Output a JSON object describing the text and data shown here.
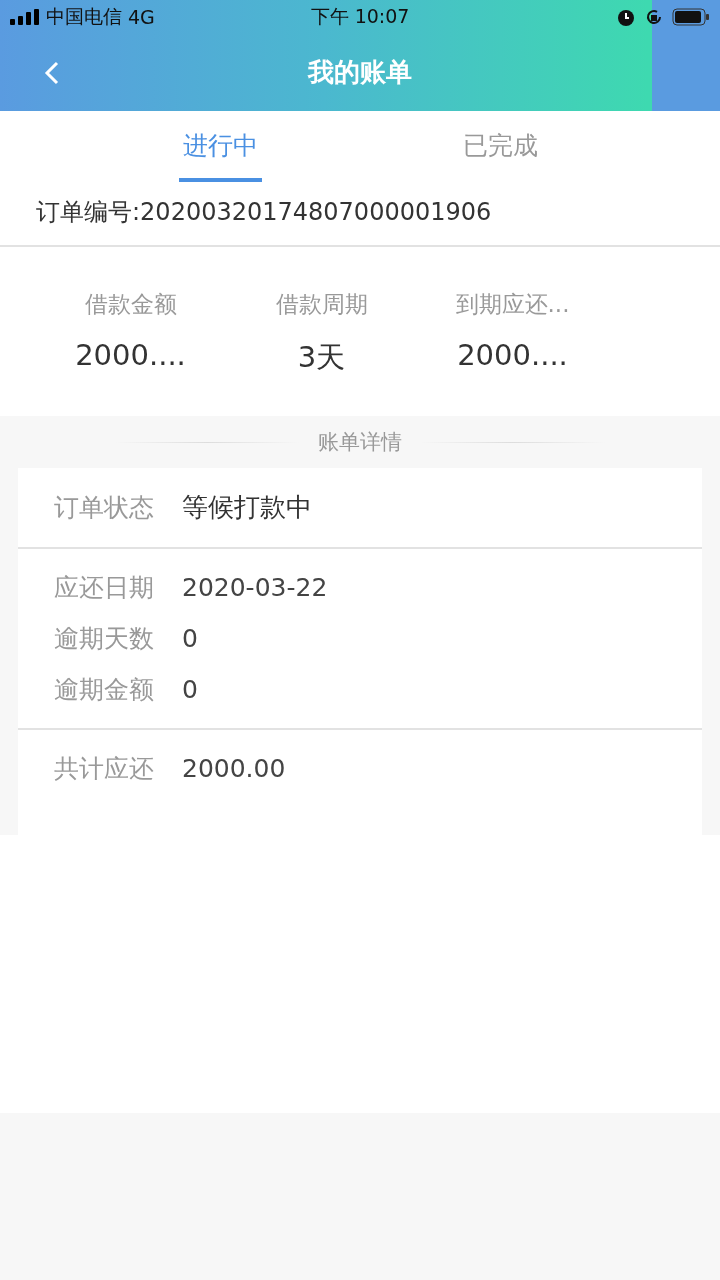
{
  "status_bar": {
    "carrier": "中国电信",
    "network": "4G",
    "time": "下午 10:07"
  },
  "header": {
    "title": "我的账单"
  },
  "tabs": [
    {
      "label": "进行中",
      "selected": true
    },
    {
      "label": "已完成",
      "selected": false
    }
  ],
  "order_number": "订单编号:20200320174807000001906",
  "summary": [
    {
      "label": "借款金额",
      "value": "2000...."
    },
    {
      "label": "借款周期",
      "value": "3天"
    },
    {
      "label": "到期应还...",
      "value": "2000...."
    }
  ],
  "detail": {
    "title": "账单详情",
    "groups": [
      [
        {
          "label": "订单状态",
          "value": "等候打款中"
        }
      ],
      [
        {
          "label": "应还日期",
          "value": "2020-03-22"
        },
        {
          "label": "逾期天数",
          "value": "0"
        },
        {
          "label": "逾期金额",
          "value": "0"
        }
      ],
      [
        {
          "label": "共计应还",
          "value": "2000.00"
        }
      ]
    ]
  }
}
